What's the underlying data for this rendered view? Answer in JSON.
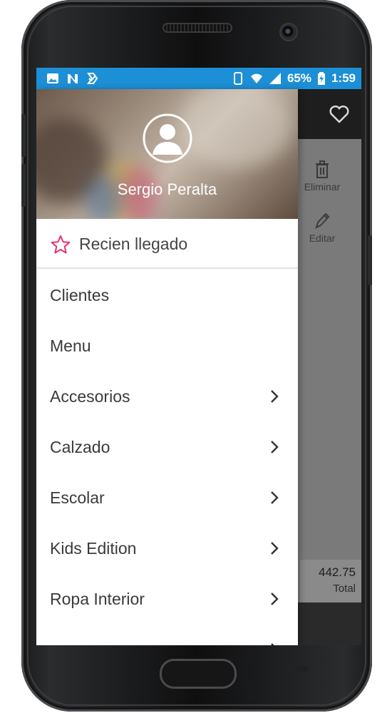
{
  "status_bar": {
    "battery": "65%",
    "time": "1:59",
    "left_icons": [
      "image-icon",
      "n-icon",
      "clipboard-check-icon"
    ],
    "right_icons": [
      "phone-icon",
      "wifi-icon",
      "signal-icon",
      "battery-charging-icon"
    ]
  },
  "drawer": {
    "user_name": "Sergio Peralta",
    "featured": {
      "label": "Recien llegado",
      "icon": "star-outline-icon",
      "icon_color": "#e8336d"
    },
    "items": [
      {
        "label": "Clientes",
        "has_submenu": false
      },
      {
        "label": "Menu",
        "has_submenu": false
      },
      {
        "label": "Accesorios",
        "has_submenu": true
      },
      {
        "label": "Calzado",
        "has_submenu": true
      },
      {
        "label": "Escolar",
        "has_submenu": true
      },
      {
        "label": "Kids Edition",
        "has_submenu": true
      },
      {
        "label": "Ropa Interior",
        "has_submenu": true
      }
    ]
  },
  "background_app": {
    "actions": [
      {
        "label": "Eliminar",
        "icon": "trash-icon"
      },
      {
        "label": "Editar",
        "icon": "pencil-icon"
      }
    ],
    "total_value": "442.75",
    "total_label": "Total"
  },
  "colors": {
    "status_bar": "#1c8fd6",
    "accent": "#e8336d",
    "scrim": "#7a7a7a"
  }
}
